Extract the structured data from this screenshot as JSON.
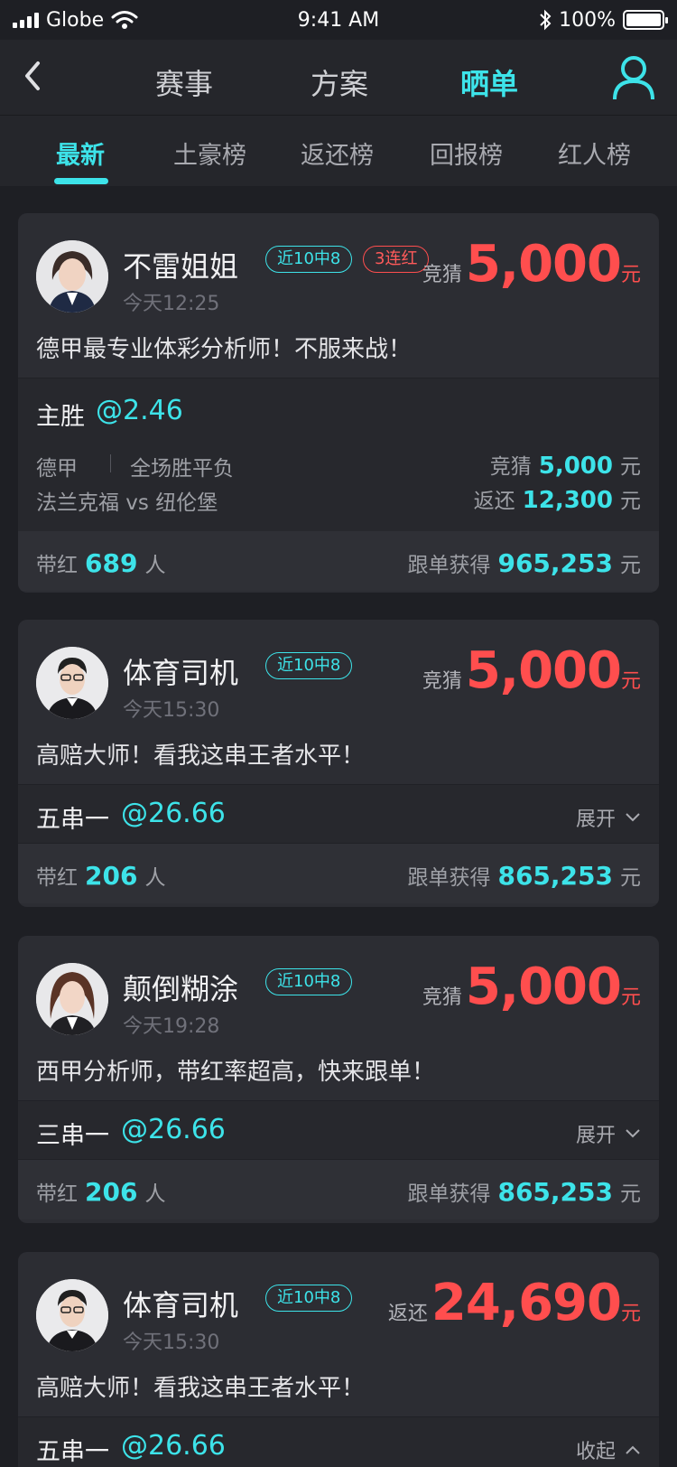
{
  "status_bar": {
    "carrier": "Globe",
    "time": "9:41 AM",
    "battery": "100%"
  },
  "nav": {
    "tabs": [
      {
        "label": "赛事",
        "active": false
      },
      {
        "label": "方案",
        "active": false
      },
      {
        "label": "晒单",
        "active": true
      }
    ]
  },
  "subtabs": [
    {
      "label": "最新",
      "active": true
    },
    {
      "label": "土豪榜",
      "active": false
    },
    {
      "label": "返还榜",
      "active": false
    },
    {
      "label": "回报榜",
      "active": false
    },
    {
      "label": "红人榜",
      "active": false
    }
  ],
  "colors": {
    "accent": "#3de3e9",
    "highlight_red": "#ff4e4e",
    "background": "#1e1f24",
    "card": "#2c2d33"
  },
  "cards": [
    {
      "name": "不雷姐姐",
      "tag": "近10中8",
      "streak": "3连红",
      "time": "今天12:25",
      "bet_label": "竞猜",
      "bet_amount": "5,000",
      "unit": "元",
      "slogan": "德甲最专业体彩分析师！不服来战！",
      "plan_name": "主胜",
      "odds": "@2.46",
      "detail": {
        "league": "德甲",
        "play_type": "全场胜平负",
        "match": "法兰克福 vs 纽伦堡",
        "bet_label": "竞猜",
        "bet_value": "5,000",
        "return_label": "返还",
        "return_value": "12,300",
        "unit": "元"
      },
      "follow_label": "带红",
      "follow_count": "689",
      "follow_unit": "人",
      "gain_label": "跟单获得",
      "gain_value": "965,253",
      "gain_unit": "元"
    },
    {
      "name": "体育司机",
      "tag": "近10中8",
      "time": "今天15:30",
      "bet_label": "竞猜",
      "bet_amount": "5,000",
      "unit": "元",
      "slogan": "高赔大师！看我这串王者水平！",
      "plan_name": "五串一",
      "odds": "@26.66",
      "toggle": "展开",
      "follow_label": "带红",
      "follow_count": "206",
      "follow_unit": "人",
      "gain_label": "跟单获得",
      "gain_value": "865,253",
      "gain_unit": "元"
    },
    {
      "name": "颠倒糊涂",
      "tag": "近10中8",
      "time": "今天19:28",
      "bet_label": "竞猜",
      "bet_amount": "5,000",
      "unit": "元",
      "slogan": "西甲分析师，带红率超高，快来跟单！",
      "plan_name": "三串一",
      "odds": "@26.66",
      "toggle": "展开",
      "follow_label": "带红",
      "follow_count": "206",
      "follow_unit": "人",
      "gain_label": "跟单获得",
      "gain_value": "865,253",
      "gain_unit": "元"
    },
    {
      "name": "体育司机",
      "tag": "近10中8",
      "time": "今天15:30",
      "bet_label": "返还",
      "bet_amount": "24,690",
      "unit": "元",
      "slogan": "高赔大师！看我这串王者水平！",
      "plan_name": "五串一",
      "odds": "@26.66",
      "toggle": "收起"
    }
  ]
}
